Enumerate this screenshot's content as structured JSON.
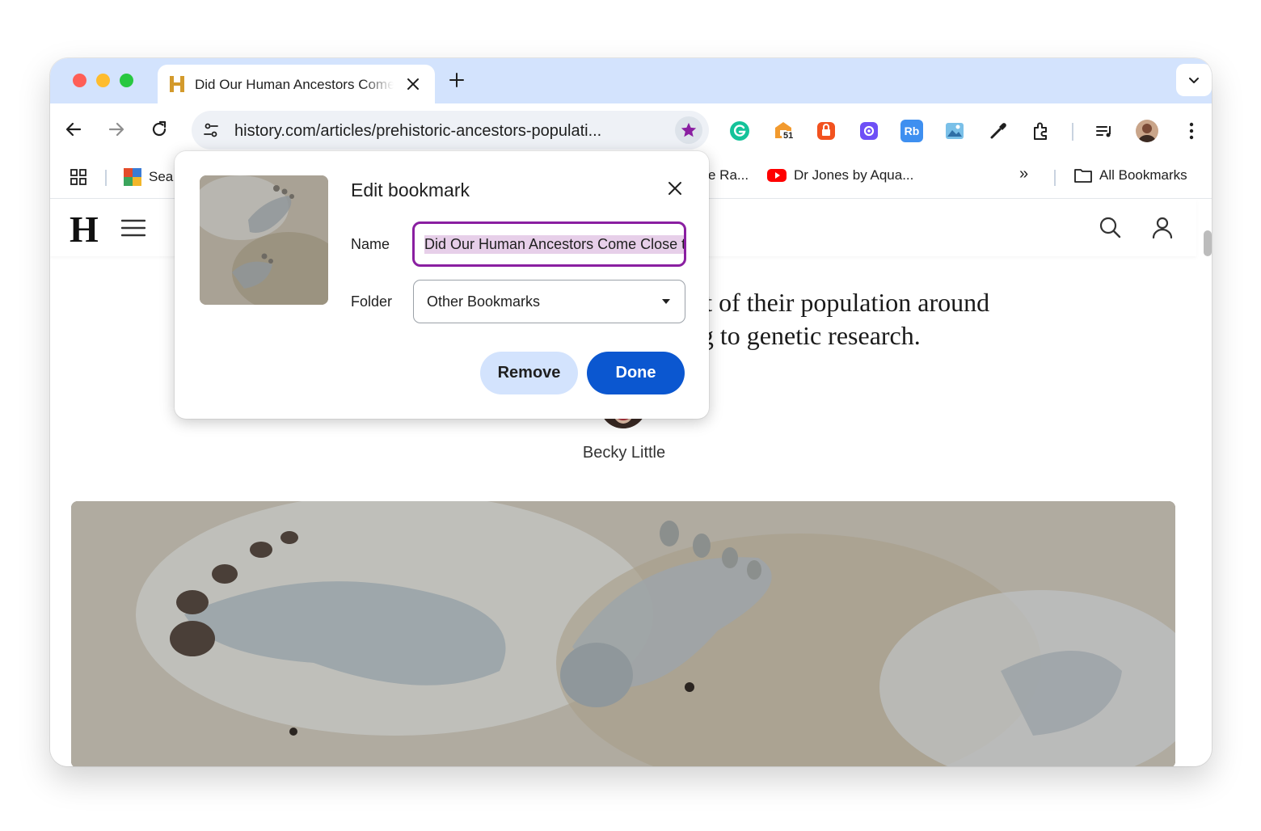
{
  "tab": {
    "title": "Did Our Human Ancestors Come Close to Extinction?"
  },
  "toolbar": {
    "url": "history.com/articles/prehistoric-ancestors-populati..."
  },
  "extensions": {
    "badge_count": "51",
    "ext5_label": "Rb"
  },
  "bookmarks_bar": {
    "item1": "Sea",
    "item2": "e Ra...",
    "item3": "Dr Jones by Aqua...",
    "overflow": "»",
    "all_bookmarks": "All Bookmarks"
  },
  "site": {
    "logo": "H",
    "dek_line1": "ent of their population around",
    "dek_line2": "ing to genetic research.",
    "author": "Becky Little"
  },
  "popup": {
    "title": "Edit bookmark",
    "name_label": "Name",
    "name_value": "Did Our Human Ancestors Come Close to Extinction?",
    "folder_label": "Folder",
    "folder_value": "Other Bookmarks",
    "remove_label": "Remove",
    "done_label": "Done"
  },
  "colors": {
    "tabstrip": "#d3e3fd",
    "accent": "#0b57d0",
    "bookmark_star": "#8a1fa1"
  }
}
